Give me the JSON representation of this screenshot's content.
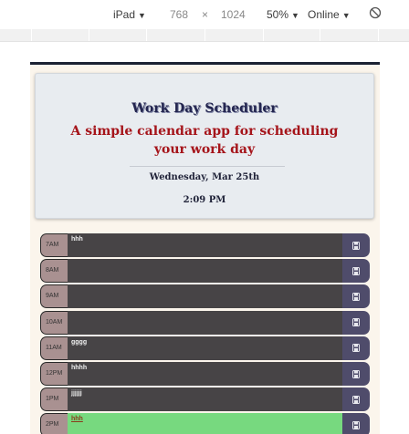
{
  "devtools": {
    "device": "iPad",
    "width": "768",
    "times": "×",
    "height": "1024",
    "zoom": "50%",
    "network": "Online"
  },
  "header": {
    "title": "Work Day Scheduler",
    "subtitle": "A simple calendar app for scheduling your work day",
    "date": "Wednesday, Mar 25th",
    "time": "2:09 PM"
  },
  "schedule": {
    "rows": [
      {
        "hour": "7AM",
        "text": "hhh",
        "state": "past"
      },
      {
        "hour": "8AM",
        "text": "",
        "state": "past"
      },
      {
        "hour": "9AM",
        "text": "",
        "state": "past"
      },
      {
        "hour": "10AM",
        "text": "",
        "state": "past"
      },
      {
        "hour": "11AM",
        "text": "gggg",
        "state": "past"
      },
      {
        "hour": "12PM",
        "text": "hhhh",
        "state": "past"
      },
      {
        "hour": "1PM",
        "text": "jjjjjj",
        "state": "past"
      },
      {
        "hour": "2PM",
        "text": "hhh",
        "state": "present"
      }
    ],
    "save_icon": "save-icon"
  },
  "colors": {
    "past": "#474446",
    "present": "#77d97f",
    "save": "#4f4c6b",
    "hour": "#a99191",
    "title": "#23254f",
    "subtitle": "#a5141a"
  }
}
